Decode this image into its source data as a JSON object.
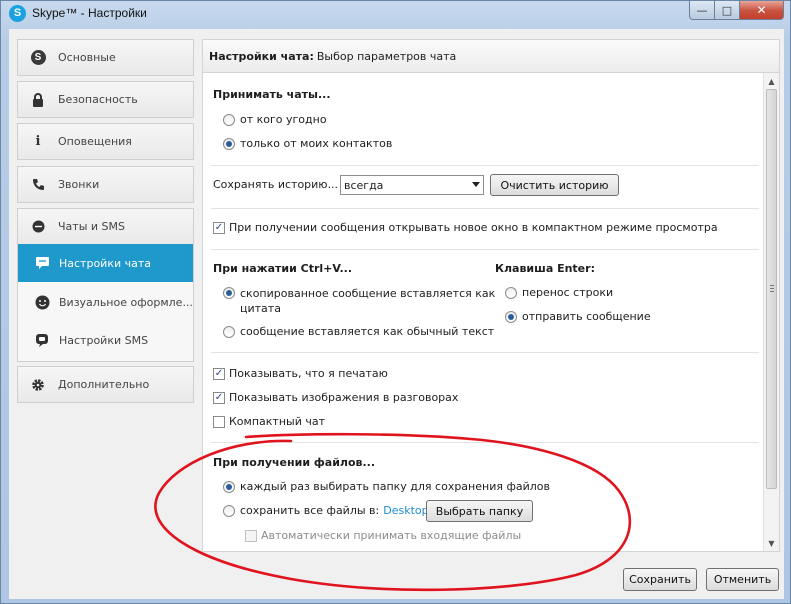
{
  "window": {
    "title": "Skype™ - Настройки",
    "app_icon_letter": "S"
  },
  "sidebar": {
    "items": [
      {
        "id": "general",
        "label": "Основные",
        "icon": "skype-icon"
      },
      {
        "id": "security",
        "label": "Безопасность",
        "icon": "lock-icon"
      },
      {
        "id": "notifications",
        "label": "Оповещения",
        "icon": "info-icon"
      },
      {
        "id": "calls",
        "label": "Звонки",
        "icon": "phone-icon"
      },
      {
        "id": "chats",
        "label": "Чаты и SMS",
        "icon": "chat-bubble-icon"
      }
    ],
    "sub_items": [
      {
        "id": "chat-settings",
        "label": "Настройки чата",
        "icon": "chat-icon",
        "active": true
      },
      {
        "id": "visual-style",
        "label": "Визуальное оформле...",
        "icon": "smiley-icon",
        "active": false
      },
      {
        "id": "sms-settings",
        "label": "Настройки SMS",
        "icon": "sms-icon",
        "active": false
      }
    ],
    "advanced": {
      "label": "Дополнительно",
      "icon": "gear-icon"
    }
  },
  "header": {
    "bold": "Настройки чата:",
    "rest": "Выбор параметров чата"
  },
  "accept_chats": {
    "title": "Принимать чаты...",
    "options": [
      {
        "label": "от кого угодно",
        "selected": false
      },
      {
        "label": "только от моих контактов",
        "selected": true
      }
    ]
  },
  "history": {
    "label": "Сохранять историю...",
    "select_value": "всегда",
    "clear_button": "Очистить историю"
  },
  "compact_open": {
    "label": "При получении сообщения открывать новое окно в компактном режиме просмотра",
    "checked": true
  },
  "ctrl_v": {
    "title": "При нажатии Ctrl+V...",
    "options": [
      {
        "line1": "скопированное сообщение вставляется как",
        "line2": "цитата",
        "selected": true
      },
      {
        "line1": "сообщение вставляется как обычный текст",
        "selected": false
      }
    ]
  },
  "enter_key": {
    "title": "Клавиша Enter:",
    "options": [
      {
        "label": "перенос строки",
        "selected": false
      },
      {
        "label": "отправить сообщение",
        "selected": true
      }
    ]
  },
  "toggles": [
    {
      "id": "show-typing",
      "label": "Показывать, что я печатаю",
      "checked": true
    },
    {
      "id": "show-images",
      "label": "Показывать изображения в разговорах",
      "checked": true
    },
    {
      "id": "compact-chat",
      "label": "Компактный чат",
      "checked": false
    }
  ],
  "files": {
    "title": "При получении файлов...",
    "option_ask": {
      "label": "каждый раз выбирать папку для сохранения файлов",
      "selected": true
    },
    "option_save": {
      "label": "сохранить все файлы в:",
      "folder": "Desktop",
      "selected": false
    },
    "choose_button": "Выбрать папку",
    "auto_accept": {
      "label": "Автоматически принимать входящие файлы",
      "checked": false,
      "disabled": true
    }
  },
  "footer": {
    "save": "Сохранить",
    "cancel": "Отменить"
  },
  "colors": {
    "accent": "#1f98cc",
    "link": "#1c8fd1",
    "annotation": "#e0141e"
  }
}
